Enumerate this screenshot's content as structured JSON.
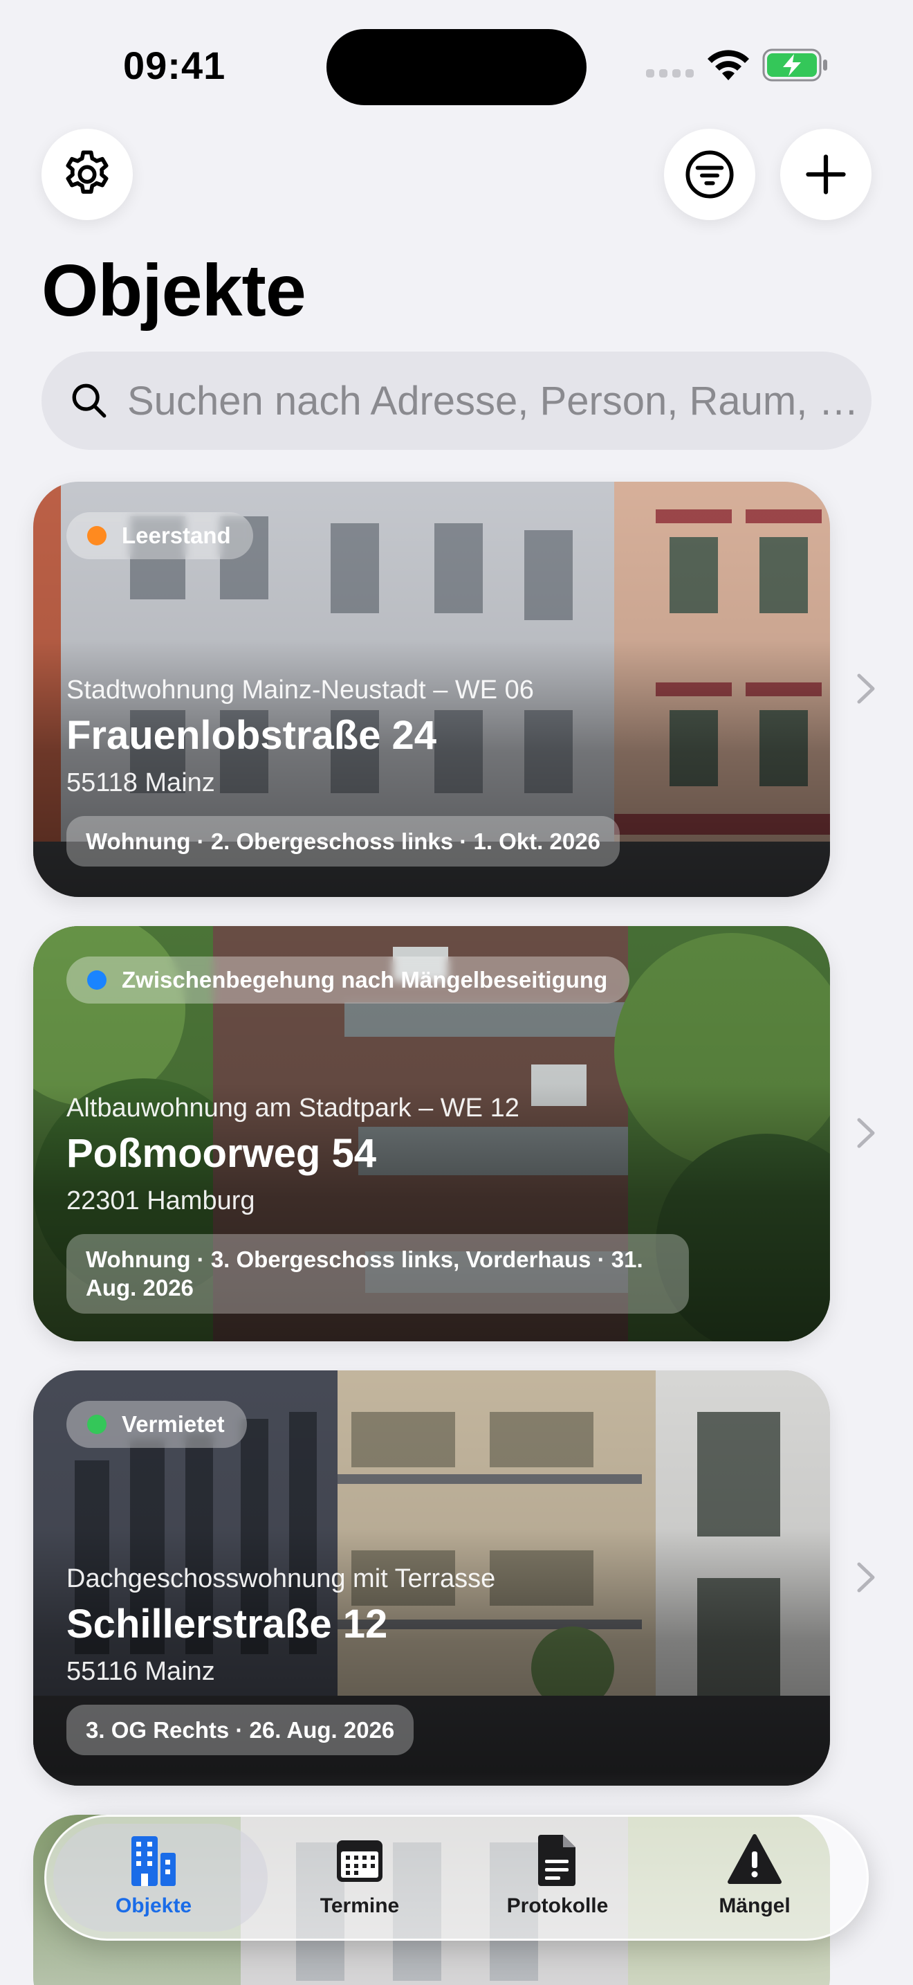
{
  "status_bar": {
    "time": "09:41"
  },
  "header": {
    "title": "Objekte"
  },
  "search": {
    "placeholder": "Suchen nach Adresse, Person, Raum, S..."
  },
  "colors": {
    "accent": "#1a6ce8",
    "status_vacant": "#ff8a1f",
    "status_inspection": "#1a84ff",
    "status_rented": "#34c759"
  },
  "properties": [
    {
      "status": "Leerstand",
      "status_color": "#ff8a1f",
      "subtitle": "Stadtwohnung Mainz-Neustadt – WE 06",
      "street": "Frauenlobstraße 24",
      "city": "55118 Mainz",
      "detail": "Wohnung · 2. Obergeschoss links · 1. Okt. 2026"
    },
    {
      "status": "Zwischenbegehung nach Mängelbeseitigung",
      "status_color": "#1a84ff",
      "subtitle": "Altbauwohnung am Stadtpark – WE 12",
      "street": "Poßmoorweg 54",
      "city": "22301 Hamburg",
      "detail": "Wohnung · 3. Obergeschoss links, Vorderhaus · 31. Aug. 2026"
    },
    {
      "status": "Vermietet",
      "status_color": "#34c759",
      "subtitle": "Dachgeschosswohnung mit Terrasse",
      "street": "Schillerstraße 12",
      "city": "55116 Mainz",
      "detail": "3. OG Rechts · 26. Aug. 2026"
    }
  ],
  "tabs": [
    {
      "label": "Objekte",
      "icon": "building-icon",
      "active": true
    },
    {
      "label": "Termine",
      "icon": "calendar-icon",
      "active": false
    },
    {
      "label": "Protokolle",
      "icon": "document-icon",
      "active": false
    },
    {
      "label": "Mängel",
      "icon": "warning-icon",
      "active": false
    }
  ]
}
